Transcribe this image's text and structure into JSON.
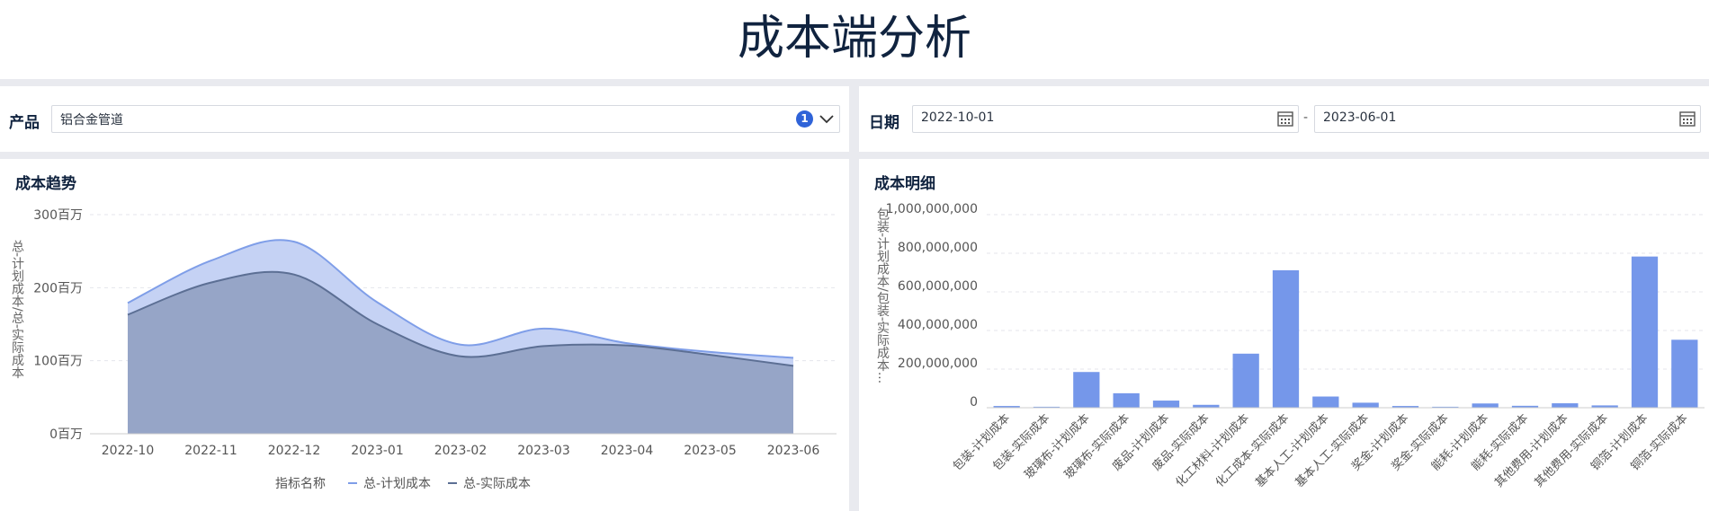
{
  "page": {
    "title": "成本端分析"
  },
  "filters": {
    "product": {
      "label": "产品",
      "value": "铝合金管道",
      "count": "1"
    },
    "date": {
      "label": "日期",
      "start": "2022-10-01",
      "separator": "-",
      "end": "2023-06-01"
    }
  },
  "colors": {
    "planned": "#7f9ee8",
    "planned_fill": "#c5d2f4",
    "actual": "#5c6f94",
    "actual_fill": "#96a5c7",
    "bar": "#7597ea"
  },
  "trend": {
    "title": "成本趋势",
    "ylabel": "总-计划成本/总-实际成本",
    "legend_title": "指标名称",
    "chart_data": {
      "type": "area",
      "x": [
        "2022-10",
        "2022-11",
        "2022-12",
        "2023-01",
        "2023-02",
        "2023-03",
        "2023-04",
        "2023-05",
        "2023-06"
      ],
      "ylim": [
        0,
        300
      ],
      "yticks": [
        "0百万",
        "100百万",
        "200百万",
        "300百万"
      ],
      "series": [
        {
          "name": "总-计划成本",
          "values": [
            179,
            237,
            263,
            180,
            122,
            144,
            124,
            112,
            104
          ]
        },
        {
          "name": "总-实际成本",
          "values": [
            163,
            207,
            218,
            150,
            106,
            120,
            121,
            108,
            93
          ]
        }
      ]
    }
  },
  "detail": {
    "title": "成本明细",
    "ylabel": "包装-计划成本/包装-实际成本...",
    "chart_data": {
      "type": "bar",
      "ylim": [
        0,
        1000000000
      ],
      "yticks": [
        "0",
        "200,000,000",
        "400,000,000",
        "600,000,000",
        "800,000,000",
        "1,000,000,000"
      ],
      "categories": [
        "包装-计划成本",
        "包装-实际成本",
        "玻璃布-计划成本",
        "玻璃布-实际成本",
        "废品-计划成本",
        "废品-实际成本",
        "化工材料-计划成本",
        "化工成本-实际成本",
        "基本人工-计划成本",
        "基本人工-实际成本",
        "奖金-计划成本",
        "奖金-实际成本",
        "能耗-计划成本",
        "能耗-实际成本",
        "其他费用-计划成本",
        "其他费用-实际成本",
        "铜箔-计划成本",
        "铜箔-实际成本"
      ],
      "values": [
        9000000,
        5000000,
        185000000,
        75000000,
        37000000,
        15000000,
        280000000,
        712000000,
        58000000,
        26000000,
        9000000,
        5000000,
        22000000,
        10000000,
        23000000,
        12000000,
        783000000,
        352000000
      ]
    }
  }
}
